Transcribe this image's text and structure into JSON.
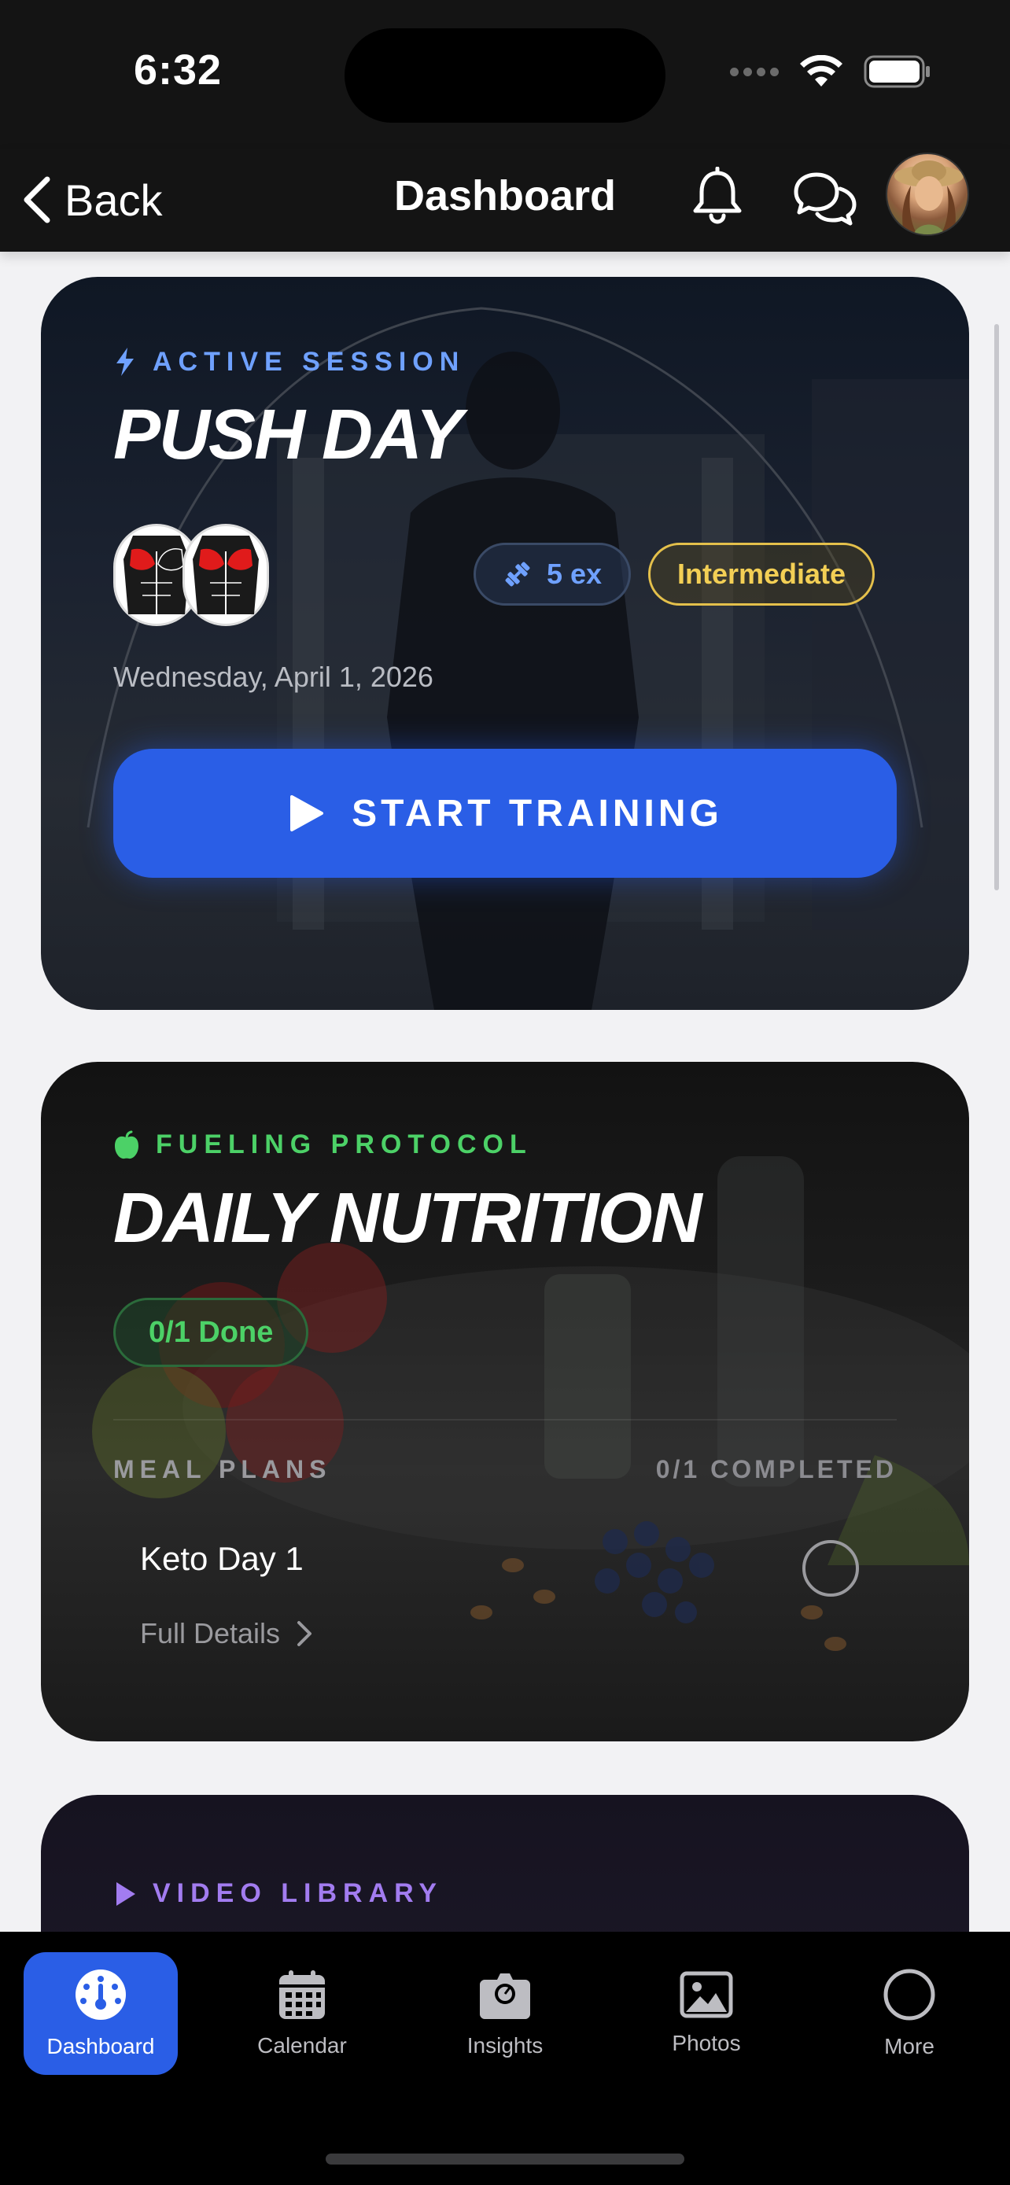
{
  "status_bar": {
    "time": "6:32"
  },
  "header": {
    "back_label": "Back",
    "title": "Dashboard"
  },
  "workout_card": {
    "eyebrow": "ACTIVE SESSION",
    "title": "PUSH DAY",
    "exercise_count": "5 ex",
    "level": "Intermediate",
    "date": "Wednesday, April 1, 2026",
    "start_label": "START TRAINING"
  },
  "nutrition_card": {
    "eyebrow": "FUELING PROTOCOL",
    "title": "DAILY NUTRITION",
    "done_badge": "0/1 Done",
    "section_label": "MEAL PLANS",
    "section_count": "0/1 COMPLETED",
    "meal_name": "Keto Day 1",
    "details_label": "Full Details"
  },
  "video_card": {
    "eyebrow": "VIDEO LIBRARY"
  },
  "tabs": [
    {
      "label": "Dashboard",
      "icon": "dashboard-gauge-icon"
    },
    {
      "label": "Calendar",
      "icon": "calendar-icon"
    },
    {
      "label": "Insights",
      "icon": "insights-icon"
    },
    {
      "label": "Photos",
      "icon": "photos-icon"
    },
    {
      "label": "More",
      "icon": "more-circle-icon"
    }
  ],
  "colors": {
    "accent_blue": "#2a5ee6",
    "session_blue": "#6fa1ff",
    "nutrition_green": "#4cd167",
    "level_yellow": "#f3cf55",
    "video_purple": "#a27cf0"
  }
}
